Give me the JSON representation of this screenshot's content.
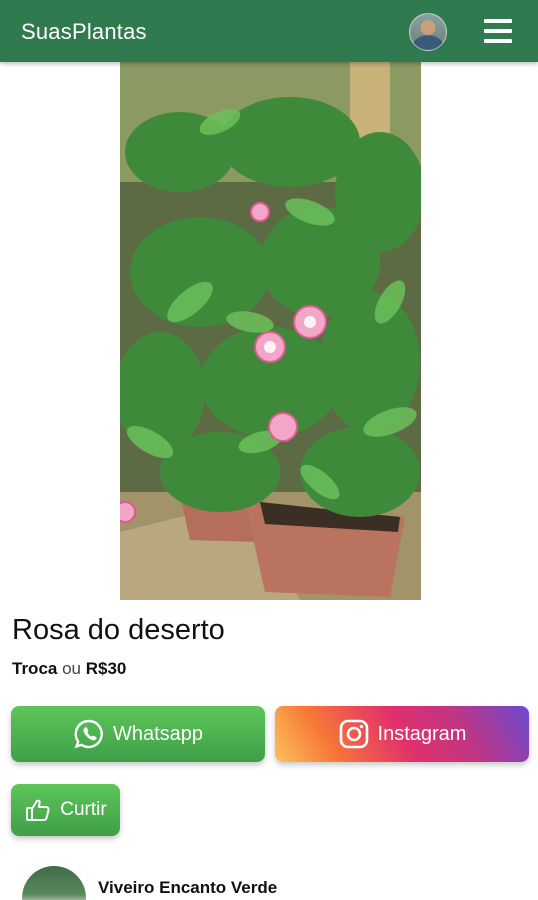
{
  "header": {
    "brand": "SuasPlantas",
    "avatar_icon": "user-avatar",
    "menu_icon": "hamburger-menu-icon",
    "color": "#2f7a4f"
  },
  "listing": {
    "photo_subject": "pink desert rose plant in pots",
    "title": "Rosa do deserto",
    "trade_label": "Troca",
    "or_label": "ou",
    "price": "R$30"
  },
  "actions": {
    "whatsapp_label": "Whatsapp",
    "instagram_label": "Instagram",
    "like_label": "Curtir",
    "whatsapp_icon": "whatsapp-icon",
    "instagram_icon": "instagram-icon",
    "like_icon": "thumbs-up-icon"
  },
  "seller": {
    "name": "Viveiro Encanto Verde"
  }
}
